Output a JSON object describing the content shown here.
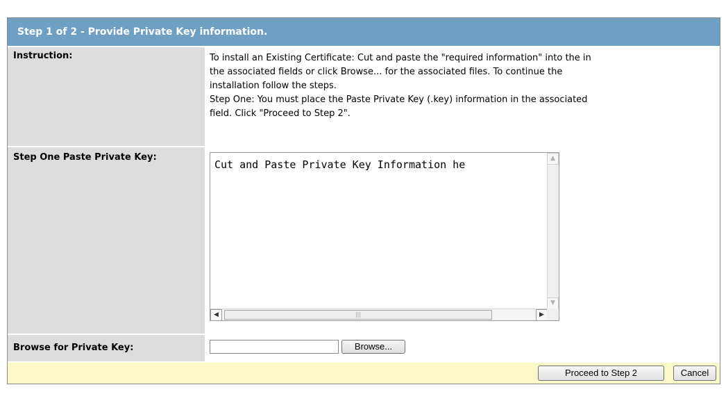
{
  "header": {
    "title": "Step 1 of 2 - Provide Private Key information."
  },
  "instruction": {
    "label": "Instruction:",
    "lines": [
      "To install an Existing Certificate: Cut and paste the \"required information\" into the in",
      "the associated fields or click Browse... for the associated files. To continue the",
      "installation follow the steps.",
      "Step One: You must place the Paste Private Key (.key) information in the associated",
      "field. Click \"Proceed to Step 2\"."
    ]
  },
  "paste_key": {
    "label": "Step One Paste Private Key:",
    "textarea_value": "Cut and Paste Private Key Information he"
  },
  "browse_key": {
    "label": "Browse for Private Key:",
    "file_value": "",
    "browse_label": "Browse..."
  },
  "footer": {
    "proceed_label": "Proceed to Step 2",
    "cancel_label": "Cancel"
  },
  "icons": {
    "scroll_up": "scroll-up-arrow-icon",
    "scroll_down": "scroll-down-arrow-icon",
    "scroll_left": "scroll-left-arrow-icon",
    "scroll_right": "scroll-right-arrow-icon",
    "thumb_grip": "scroll-grip-icon"
  }
}
